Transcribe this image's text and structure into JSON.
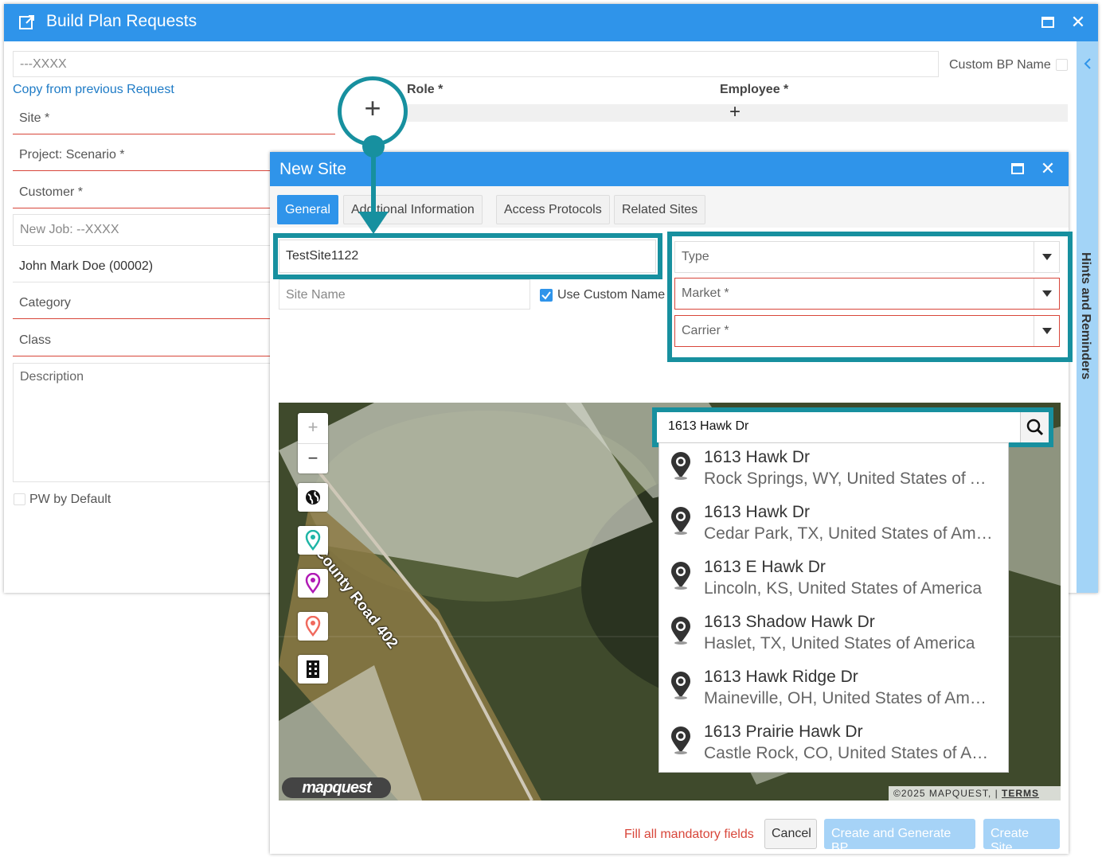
{
  "outer": {
    "title": "Build Plan Requests",
    "bp_placeholder": "---XXXX",
    "custom_bp_name": "Custom BP Name",
    "copy_link": "Copy from previous Request",
    "role_label": "Role *",
    "employee_label": "Employee *",
    "fields": {
      "site": "Site *",
      "project": "Project: Scenario *",
      "customer": "Customer *",
      "new_job": "New Job: --XXXX",
      "person": "John Mark Doe (00002)",
      "category": "Category",
      "class": "Class",
      "description": "Description"
    },
    "pw_default": "PW by Default",
    "hints": "Hints and Reminders"
  },
  "new_site": {
    "title": "New Site",
    "tabs": [
      "General",
      "Additional Information",
      "Access Protocols",
      "Related Sites"
    ],
    "site_id_value": "TestSite1122",
    "site_name_placeholder": "Site Name",
    "use_custom_name": "Use Custom Name",
    "type_label": "Type",
    "market_label": "Market *",
    "carrier_label": "Carrier *",
    "map": {
      "search_value": "1613 Hawk Dr",
      "road_label": "County Road 402",
      "logo": "mapquest",
      "copyright": "©2025 MAPQUEST,",
      "terms": "TERMS",
      "results": [
        {
          "name": "1613 Hawk Dr",
          "detail": "Rock Springs, WY, United States of America"
        },
        {
          "name": "1613 Hawk Dr",
          "detail": "Cedar Park, TX, United States of America"
        },
        {
          "name": "1613 E Hawk Dr",
          "detail": "Lincoln, KS, United States of America"
        },
        {
          "name": "1613 Shadow Hawk Dr",
          "detail": "Haslet, TX, United States of America"
        },
        {
          "name": "1613 Hawk Ridge Dr",
          "detail": "Maineville, OH, United States of America"
        },
        {
          "name": "1613 Prairie Hawk Dr",
          "detail": "Castle Rock, CO, United States of America"
        }
      ],
      "zoom_in": "+",
      "zoom_out": "−"
    },
    "footer": {
      "warning": "Fill all mandatory fields",
      "cancel": "Cancel",
      "create_generate": "Create and Generate BP",
      "create_site": "Create Site"
    }
  },
  "colors": {
    "header_blue": "#2f94ea",
    "highlight_teal": "#17909f",
    "required_red": "#d8463a",
    "link_blue": "#1e7bc6"
  }
}
